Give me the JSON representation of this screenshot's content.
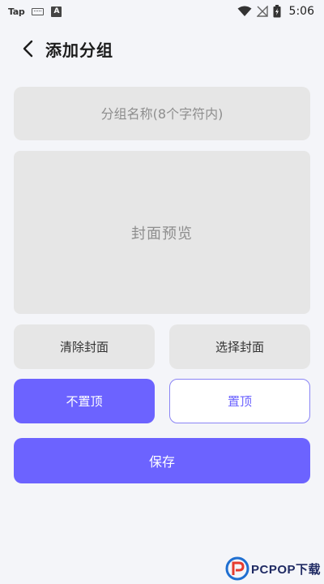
{
  "status_bar": {
    "app_label": "Tap",
    "a_badge": "A",
    "time": "5:06"
  },
  "header": {
    "title": "添加分组"
  },
  "form": {
    "name_placeholder": "分组名称(8个字符内)",
    "name_value": "",
    "cover_preview_label": "封面预览",
    "clear_cover_label": "清除封面",
    "choose_cover_label": "选择封面",
    "unpin_label": "不置顶",
    "pin_label": "置顶",
    "save_label": "保存"
  },
  "colors": {
    "accent": "#6c63ff",
    "field_bg": "#e6e6e6",
    "page_bg": "#f4f5f9"
  },
  "watermark": {
    "text": "PCPOP下载"
  }
}
